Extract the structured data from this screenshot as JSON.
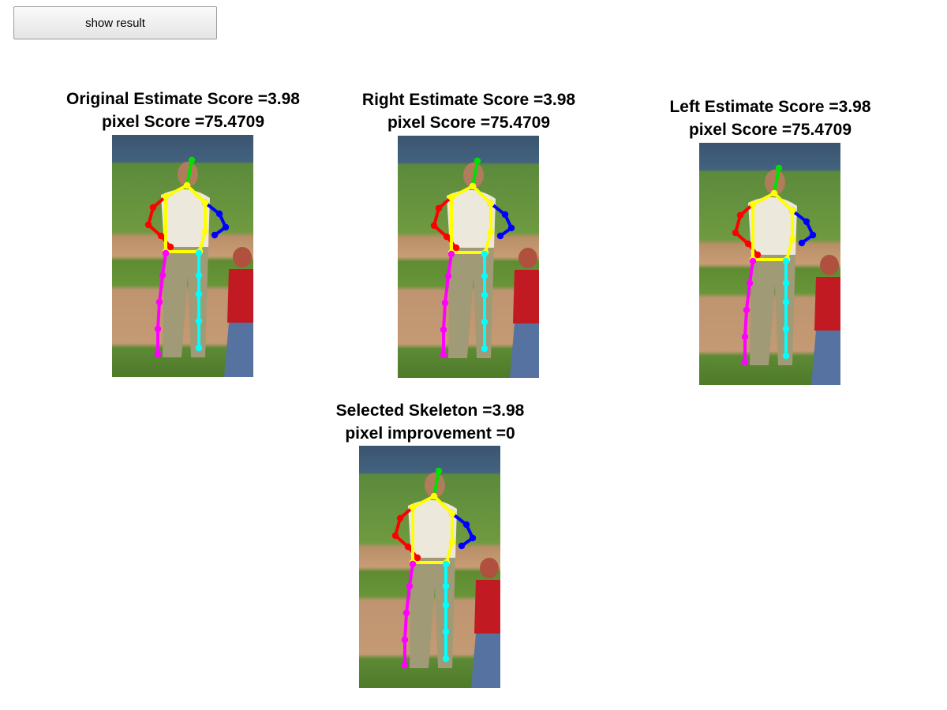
{
  "toolbar": {
    "show_result_label": "show result"
  },
  "panels": [
    {
      "title": "Original Estimate Score =3.98",
      "subtitle": "pixel Score =75.4709"
    },
    {
      "title": "Right Estimate Score =3.98",
      "subtitle": "pixel Score =75.4709"
    },
    {
      "title": "Left Estimate Score =3.98",
      "subtitle": "pixel Score =75.4709"
    },
    {
      "title": "Selected Skeleton =3.98",
      "subtitle": "pixel improvement =0"
    }
  ],
  "limb_colors": {
    "head": "#00e000",
    "torso": "#ffff00",
    "right_arm": "#ff0000",
    "left_arm": "#0000ff",
    "right_leg": "#ff00ff",
    "left_leg": "#00ffff"
  }
}
